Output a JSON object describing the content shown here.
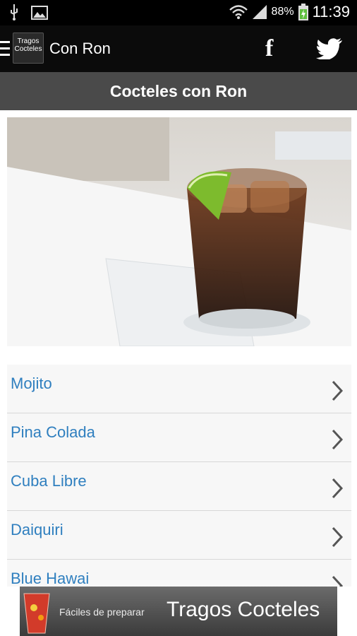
{
  "status_bar": {
    "battery_percent": "88%",
    "time": "11:39",
    "icons": [
      "usb-icon",
      "image-icon",
      "wifi-icon",
      "signal-icon",
      "battery-charging-icon"
    ]
  },
  "app_bar": {
    "logo_text_line1": "Tragos",
    "logo_text_line2": "Cocteles",
    "title": "Con Ron",
    "icons": [
      "menu-icon",
      "facebook-icon",
      "twitter-icon"
    ]
  },
  "section": {
    "title": "Cocteles con Ron"
  },
  "list": {
    "items": [
      {
        "label": "Mojito"
      },
      {
        "label": "Pina Colada"
      },
      {
        "label": "Cuba Libre"
      },
      {
        "label": "Daiquiri"
      },
      {
        "label": "Blue Hawai"
      }
    ]
  },
  "ad": {
    "tagline": "Fáciles de preparar",
    "brand": "Tragos Cocteles"
  },
  "colors": {
    "link": "#2f7fbf",
    "header": "#4a4a4a",
    "appbar": "#0b0b0b"
  }
}
